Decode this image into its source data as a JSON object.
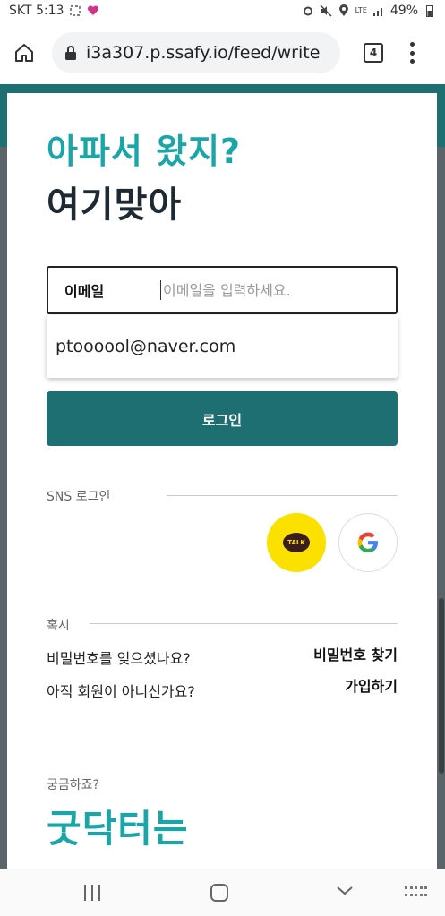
{
  "status_bar": {
    "carrier_time": "SKT 5:13",
    "battery": "49%",
    "network": "LTE"
  },
  "browser": {
    "url": "i3a307.p.ssafy.io/feed/write",
    "tab_count": "4"
  },
  "page": {
    "headline_line1": "아파서 왔지?",
    "headline_line2": "여기맞아",
    "email_label": "이메일",
    "email_placeholder": "이메일을 입력하세요.",
    "email_value": "",
    "autocomplete_suggestion": "ptoooool@naver.com",
    "login_button": "로그인",
    "sns_label": "SNS 로그인",
    "kakao_text": "TALK",
    "question_label": "혹시",
    "forgot_password_text": "비밀번호를 잊으셨나요?",
    "find_password_link": "비밀번호 찾기",
    "not_member_text": "아직 회원이 아니신가요?",
    "signup_link": "가입하기",
    "curious_label": "궁금하죠?",
    "brand_heading": "굿닥터는"
  },
  "colors": {
    "accent_teal": "#1aa5a8",
    "button_teal": "#1d6f72",
    "kakao_yellow": "#fae100"
  }
}
